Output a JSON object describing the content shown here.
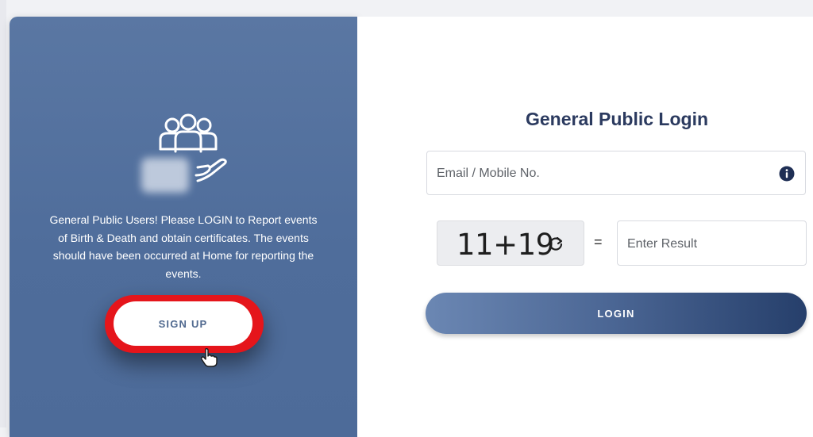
{
  "left_panel": {
    "description": "General Public Users! Please LOGIN to Report events of Birth & Death and obtain certificates. The events should have been occurred at Home for reporting the events.",
    "signup_label": "SIGN UP",
    "illustration_icon": "users-hand-icon",
    "cursor_icon": "hand-pointer-icon"
  },
  "login_form": {
    "title": "General Public Login",
    "email_placeholder": "Email / Mobile No.",
    "info_icon": "info-icon",
    "captcha": "11+19",
    "refresh_icon": "refresh-icon",
    "equals": "=",
    "result_placeholder": "Enter Result",
    "login_label": "LOGIN"
  },
  "colors": {
    "panel_blue": "#5a77a3",
    "title_navy": "#2b3a5f",
    "highlight_red": "#e5151b"
  }
}
